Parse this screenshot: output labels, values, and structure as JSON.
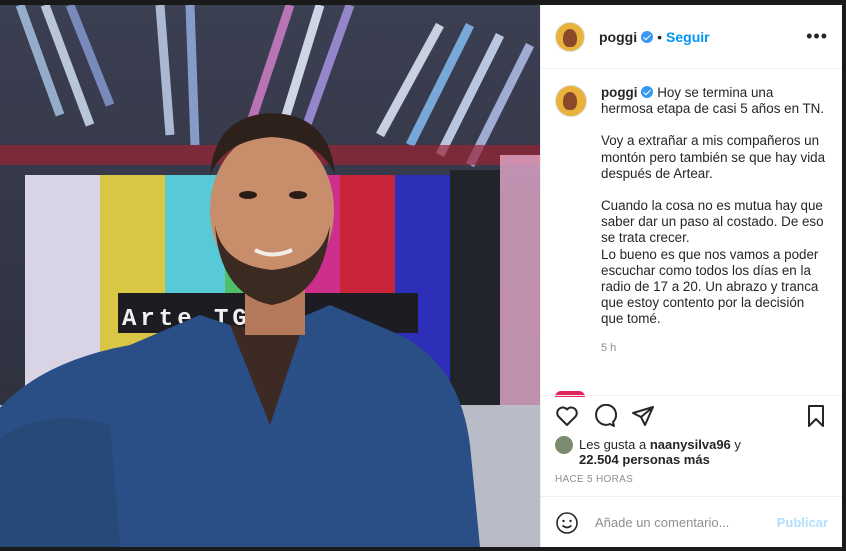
{
  "post": {
    "media_overlay_text": "Arte   TG 1",
    "author": {
      "username": "poggi",
      "separator": "•",
      "follow_label": "Seguir",
      "more_label": "•••"
    },
    "caption": {
      "username": "poggi",
      "paragraphs": [
        "Hoy se termina una hermosa etapa de casi 5 años en TN.",
        "Voy a extrañar a mis compañeros un montón pero también se que hay vida después de Artear.",
        "Cuando la cosa no es mutua hay que saber dar un paso al costado. De eso se trata crecer.",
        "Lo bueno es que nos vamos a poder escuchar como todos los días en la radio de 17 a 20. Un abrazo y tranca que estoy contento por la decisión que tomé."
      ],
      "time": "5 h"
    },
    "likes": {
      "prefix": "Les gusta a",
      "user": "naanysilva96",
      "connector": "y",
      "count_text": "22.504 personas más"
    },
    "posted_ago": "HACE 5 HORAS",
    "comment": {
      "placeholder": "Añade un comentario...",
      "publish_label": "Publicar"
    },
    "icons": [
      "heart-icon",
      "comment-icon",
      "share-icon",
      "bookmark-icon",
      "emoji-icon",
      "verified-icon"
    ],
    "colors": {
      "accent": "#0095f6",
      "publish_disabled": "#b2dffc",
      "text": "#262626",
      "muted": "#8e8e8e"
    }
  }
}
